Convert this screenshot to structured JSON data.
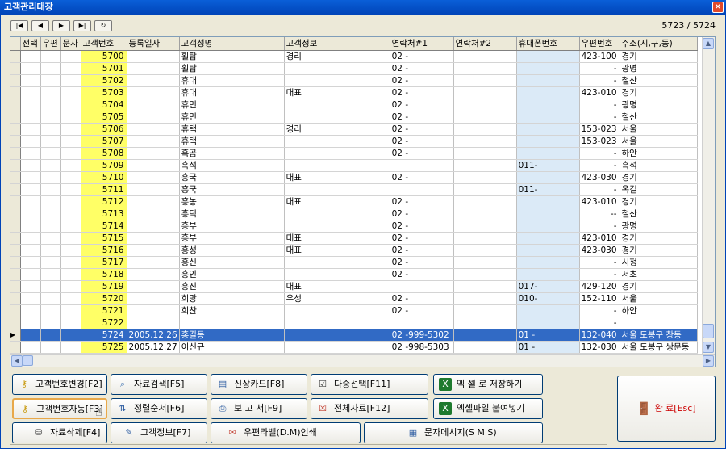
{
  "window": {
    "title": "고객관리대장",
    "close_glyph": "×"
  },
  "nav": {
    "first": "|◀",
    "prev": "◀",
    "next": "▶",
    "last": "▶|",
    "refresh": "↻",
    "counter": "5723 / 5724"
  },
  "columns": [
    "선택",
    "우편",
    "문자",
    "고객번호",
    "등록일자",
    "고객성명",
    "고객정보",
    "연락처#1",
    "연락처#2",
    "휴대폰번호",
    "우편번호",
    "주소(시,구,동)"
  ],
  "rows": [
    {
      "num": "5700",
      "date": "",
      "name": "횔탑",
      "info": "경리",
      "tel1": "02  -",
      "tel2": "",
      "mob": "",
      "zip": "423-100",
      "addr": "경기"
    },
    {
      "num": "5701",
      "date": "",
      "name": "횔탑",
      "info": "",
      "tel1": "02  -",
      "tel2": "",
      "mob": "",
      "zip": "-",
      "addr": "광명"
    },
    {
      "num": "5702",
      "date": "",
      "name": "휴대",
      "info": "",
      "tel1": "02  -",
      "tel2": "",
      "mob": "",
      "zip": "-",
      "addr": "철산"
    },
    {
      "num": "5703",
      "date": "",
      "name": "휴대",
      "info": "대표",
      "tel1": "02  -",
      "tel2": "",
      "mob": "",
      "zip": "423-010",
      "addr": "경기"
    },
    {
      "num": "5704",
      "date": "",
      "name": "휴먼",
      "info": "",
      "tel1": "02  -",
      "tel2": "",
      "mob": "",
      "zip": "-",
      "addr": "광명"
    },
    {
      "num": "5705",
      "date": "",
      "name": "휴먼",
      "info": "",
      "tel1": "02  -",
      "tel2": "",
      "mob": "",
      "zip": "-",
      "addr": "철산"
    },
    {
      "num": "5706",
      "date": "",
      "name": "휴택",
      "info": "경리",
      "tel1": "02  -",
      "tel2": "",
      "mob": "",
      "zip": "153-023",
      "addr": "서울"
    },
    {
      "num": "5707",
      "date": "",
      "name": "휴택",
      "info": "",
      "tel1": "02  -",
      "tel2": "",
      "mob": "",
      "zip": "153-023",
      "addr": "서울"
    },
    {
      "num": "5708",
      "date": "",
      "name": "흑곰",
      "info": "",
      "tel1": "02  -",
      "tel2": "",
      "mob": "",
      "zip": "-",
      "addr": "하안"
    },
    {
      "num": "5709",
      "date": "",
      "name": "흑석",
      "info": "",
      "tel1": "",
      "tel2": "",
      "mob": "011-",
      "zip": "-",
      "addr": "흑석"
    },
    {
      "num": "5710",
      "date": "",
      "name": "흥국",
      "info": "대표",
      "tel1": "02  -",
      "tel2": "",
      "mob": "",
      "zip": "423-030",
      "addr": "경기"
    },
    {
      "num": "5711",
      "date": "",
      "name": "흥국",
      "info": "",
      "tel1": "",
      "tel2": "",
      "mob": "011-",
      "zip": "-",
      "addr": "옥길"
    },
    {
      "num": "5712",
      "date": "",
      "name": "흥농",
      "info": "대표",
      "tel1": "02  -",
      "tel2": "",
      "mob": "",
      "zip": "423-010",
      "addr": "경기"
    },
    {
      "num": "5713",
      "date": "",
      "name": "흥덕",
      "info": "",
      "tel1": "02  -",
      "tel2": "",
      "mob": "",
      "zip": "--",
      "addr": "철산"
    },
    {
      "num": "5714",
      "date": "",
      "name": "흥부",
      "info": "",
      "tel1": "02  -",
      "tel2": "",
      "mob": "",
      "zip": "-",
      "addr": "광명"
    },
    {
      "num": "5715",
      "date": "",
      "name": "흥부",
      "info": "대표",
      "tel1": "02  -",
      "tel2": "",
      "mob": "",
      "zip": "423-010",
      "addr": "경기"
    },
    {
      "num": "5716",
      "date": "",
      "name": "흥성",
      "info": "대표",
      "tel1": "02  -",
      "tel2": "",
      "mob": "",
      "zip": "423-030",
      "addr": "경기"
    },
    {
      "num": "5717",
      "date": "",
      "name": "흥신",
      "info": "",
      "tel1": "02  -",
      "tel2": "",
      "mob": "",
      "zip": "-",
      "addr": "시청"
    },
    {
      "num": "5718",
      "date": "",
      "name": "흥인",
      "info": "",
      "tel1": "02  -",
      "tel2": "",
      "mob": "",
      "zip": "-",
      "addr": "서초"
    },
    {
      "num": "5719",
      "date": "",
      "name": "흥진",
      "info": "대표",
      "tel1": "",
      "tel2": "",
      "mob": "017-",
      "zip": "429-120",
      "addr": "경기"
    },
    {
      "num": "5720",
      "date": "",
      "name": "희망",
      "info": "우성",
      "tel1": "02  -",
      "tel2": "",
      "mob": "010-",
      "zip": "152-110",
      "addr": "서울"
    },
    {
      "num": "5721",
      "date": "",
      "name": "희찬",
      "info": "",
      "tel1": "02  -",
      "tel2": "",
      "mob": "",
      "zip": "-",
      "addr": "하안"
    },
    {
      "num": "5722",
      "date": "",
      "name": "",
      "info": "",
      "tel1": "",
      "tel2": "",
      "mob": "",
      "zip": "-",
      "addr": ""
    },
    {
      "num": "5724",
      "date": "2005.12.26",
      "name": "홍길동",
      "info": "",
      "tel1": "02  -999-5302",
      "tel2": "",
      "mob": "01  -",
      "zip": "132-040",
      "addr": "서울 도봉구 창동",
      "selected": true
    },
    {
      "num": "5725",
      "date": "2005.12.27",
      "name": "이신규",
      "info": "",
      "tel1": "02  -998-5303",
      "tel2": "",
      "mob": "01  -",
      "zip": "132-030",
      "addr": "서울 도봉구 쌍문동"
    }
  ],
  "buttons": {
    "change_no": "고객번호변경[F2]",
    "search": "자료검색[F5]",
    "credit_card": "신상카드[F8]",
    "multi_select": "다중선택[F11]",
    "excel_save": "엑 셀 로 저장하기",
    "auto_no": "고객번호자동[F3]",
    "sort": "정렬순서[F6]",
    "report": "보 고 서[F9]",
    "all_data": "전체자료[F12]",
    "excel_paste": "엑셀파일 붙여넣기",
    "delete": "자료삭제[F4]",
    "info": "고객정보[F7]",
    "label_print": "우편라벨(D.M)인쇄",
    "sms": "문자메시지(S M S)",
    "done": "완 료[Esc]"
  },
  "colors": {
    "titlebar": "#0a5fd8",
    "highlight_number": "#ffff66",
    "mobile_column": "#dbeaf7",
    "selected_row": "#316ac5"
  }
}
